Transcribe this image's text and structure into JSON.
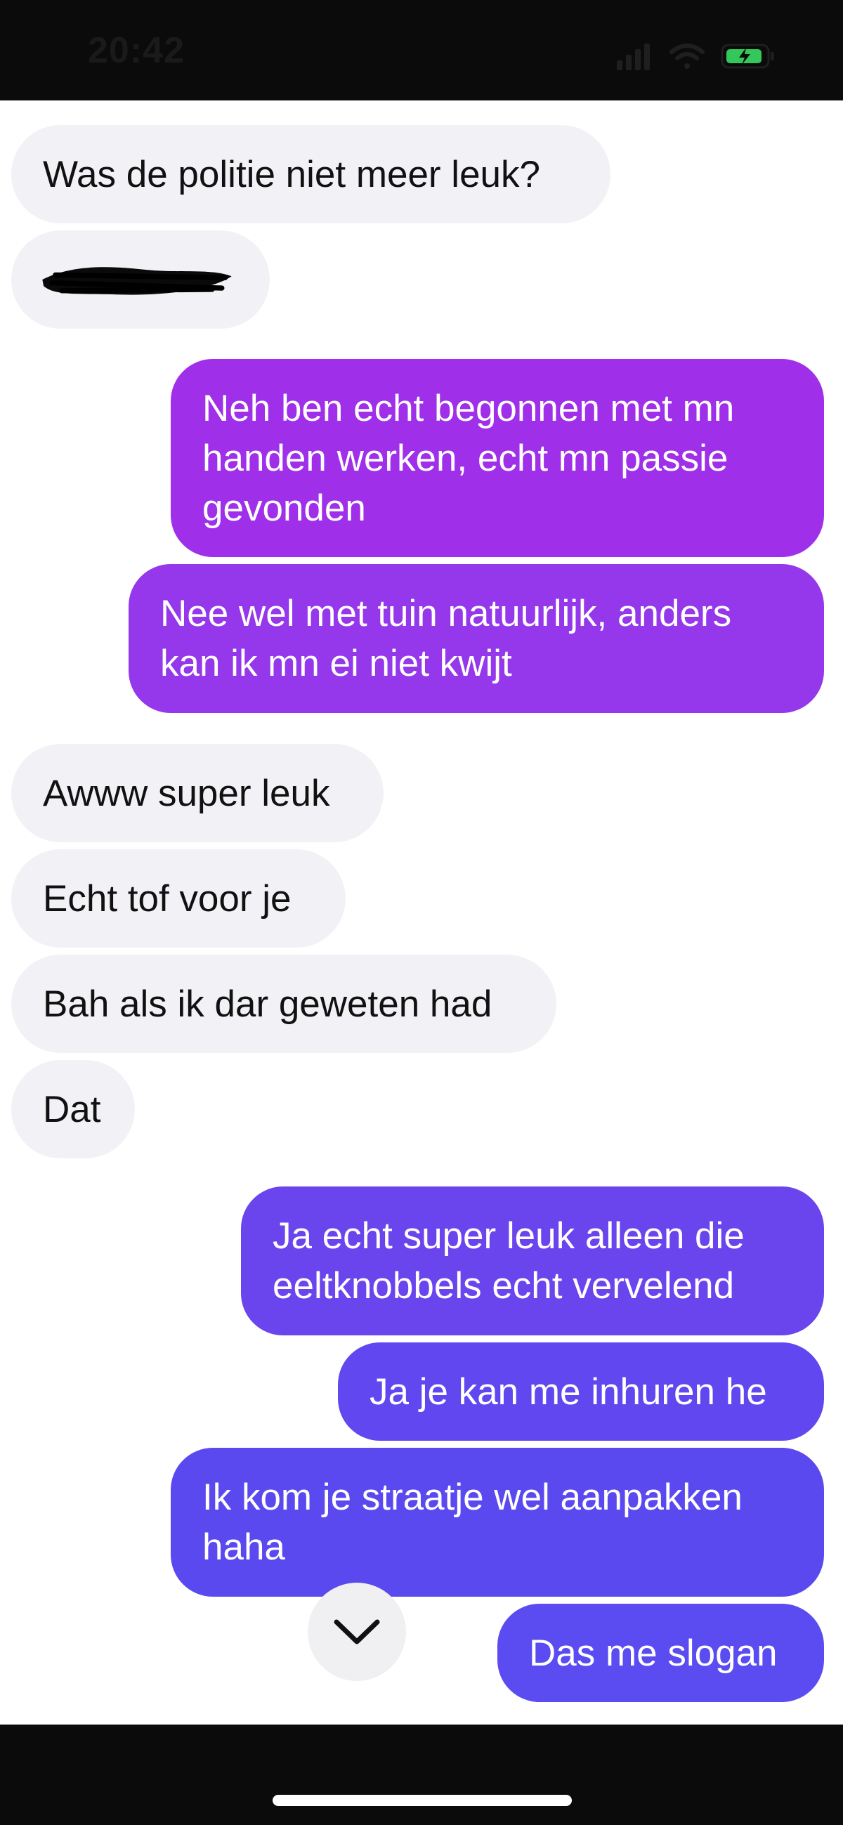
{
  "status_bar": {
    "time": "20:42",
    "signal_icon": "cellular-signal-icon",
    "wifi_icon": "wifi-icon",
    "battery_icon": "battery-charging-icon",
    "battery_color": "#34c759"
  },
  "messages": [
    {
      "direction": "incoming",
      "text": "Was de politie niet meer leuk?"
    },
    {
      "direction": "incoming",
      "text": "",
      "redacted": true
    },
    {
      "direction": "outgoing",
      "text": "Neh ben echt begonnen met mn handen werken, echt mn passie gevonden"
    },
    {
      "direction": "outgoing",
      "text": "Nee wel met tuin natuurlijk, anders kan ik mn ei niet kwijt"
    },
    {
      "direction": "incoming",
      "text": "Awww super leuk"
    },
    {
      "direction": "incoming",
      "text": "Echt tof voor je"
    },
    {
      "direction": "incoming",
      "text": "Bah als ik dar geweten had"
    },
    {
      "direction": "incoming",
      "text": "Dat"
    },
    {
      "direction": "outgoing",
      "text": "Ja echt super leuk alleen die eeltknobbels echt vervelend"
    },
    {
      "direction": "outgoing",
      "text": "Ja je kan me inhuren he"
    },
    {
      "direction": "outgoing",
      "text": "Ik kom je straatje wel aanpakken haha"
    },
    {
      "direction": "outgoing",
      "text": "Das me slogan"
    }
  ],
  "scroll_button": {
    "icon": "chevron-down-icon"
  },
  "colors": {
    "incoming_bubble": "#f2f2f6",
    "outgoing_purple": "#9b32e6",
    "outgoing_blue": "#5b4af0"
  }
}
